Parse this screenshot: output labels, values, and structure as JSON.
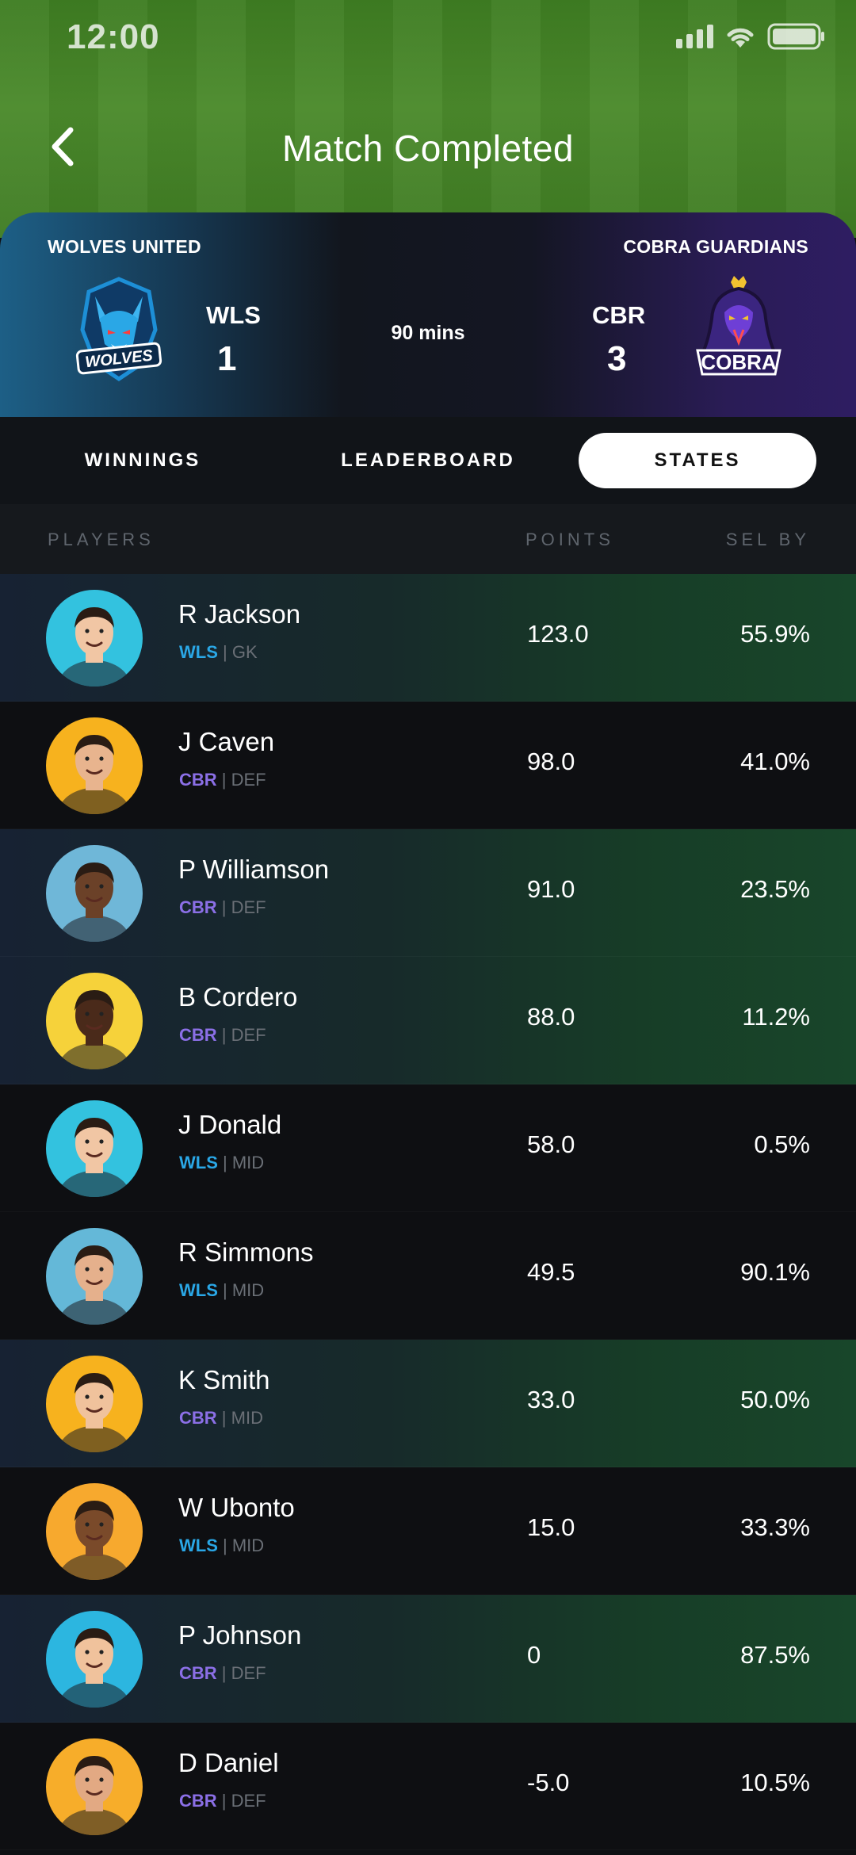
{
  "status_bar": {
    "time": "12:00"
  },
  "header": {
    "title": "Match Completed"
  },
  "match": {
    "home": {
      "name": "WOLVES UNITED",
      "abbr": "WLS",
      "score": "1",
      "logo_text": "WOLVES"
    },
    "away": {
      "name": "COBRA GUARDIANS",
      "abbr": "CBR",
      "score": "3",
      "logo_text": "COBRA"
    },
    "duration": "90 mins"
  },
  "tabs": [
    {
      "label": "WINNINGS",
      "active": false
    },
    {
      "label": "LEADERBOARD",
      "active": false
    },
    {
      "label": "STATES",
      "active": true
    }
  ],
  "table": {
    "headers": {
      "players": "PLAYERS",
      "points": "POINTS",
      "sel_by": "SEL BY"
    },
    "rows": [
      {
        "name": "R Jackson",
        "team": "WLS",
        "position": "GK",
        "points": "123.0",
        "sel_by": "55.9%",
        "avatar_bg": "#33c2df",
        "highlight": true
      },
      {
        "name": "J Caven",
        "team": "CBR",
        "position": "DEF",
        "points": "98.0",
        "sel_by": "41.0%",
        "avatar_bg": "#f7b21e",
        "highlight": false
      },
      {
        "name": "P Williamson",
        "team": "CBR",
        "position": "DEF",
        "points": "91.0",
        "sel_by": "23.5%",
        "avatar_bg": "#6fb7d8",
        "highlight": true
      },
      {
        "name": "B Cordero",
        "team": "CBR",
        "position": "DEF",
        "points": "88.0",
        "sel_by": "11.2%",
        "avatar_bg": "#f6d23a",
        "highlight": true
      },
      {
        "name": "J Donald",
        "team": "WLS",
        "position": "MID",
        "points": "58.0",
        "sel_by": "0.5%",
        "avatar_bg": "#33c2df",
        "highlight": false
      },
      {
        "name": "R Simmons",
        "team": "WLS",
        "position": "MID",
        "points": "49.5",
        "sel_by": "90.1%",
        "avatar_bg": "#64b8d8",
        "highlight": false
      },
      {
        "name": "K Smith",
        "team": "CBR",
        "position": "MID",
        "points": "33.0",
        "sel_by": "50.0%",
        "avatar_bg": "#f7b21e",
        "highlight": true
      },
      {
        "name": "W Ubonto",
        "team": "WLS",
        "position": "MID",
        "points": "15.0",
        "sel_by": "33.3%",
        "avatar_bg": "#f7a92e",
        "highlight": false
      },
      {
        "name": "P Johnson",
        "team": "CBR",
        "position": "DEF",
        "points": "0",
        "sel_by": "87.5%",
        "avatar_bg": "#2cb6e0",
        "highlight": true
      },
      {
        "name": "D Daniel",
        "team": "CBR",
        "position": "DEF",
        "points": "-5.0",
        "sel_by": "10.5%",
        "avatar_bg": "#f7ad2a",
        "highlight": false
      }
    ]
  },
  "colors": {
    "wls": "#2aa7e6",
    "cbr": "#8b6fe6",
    "active_tab_bg": "#ffffff"
  }
}
